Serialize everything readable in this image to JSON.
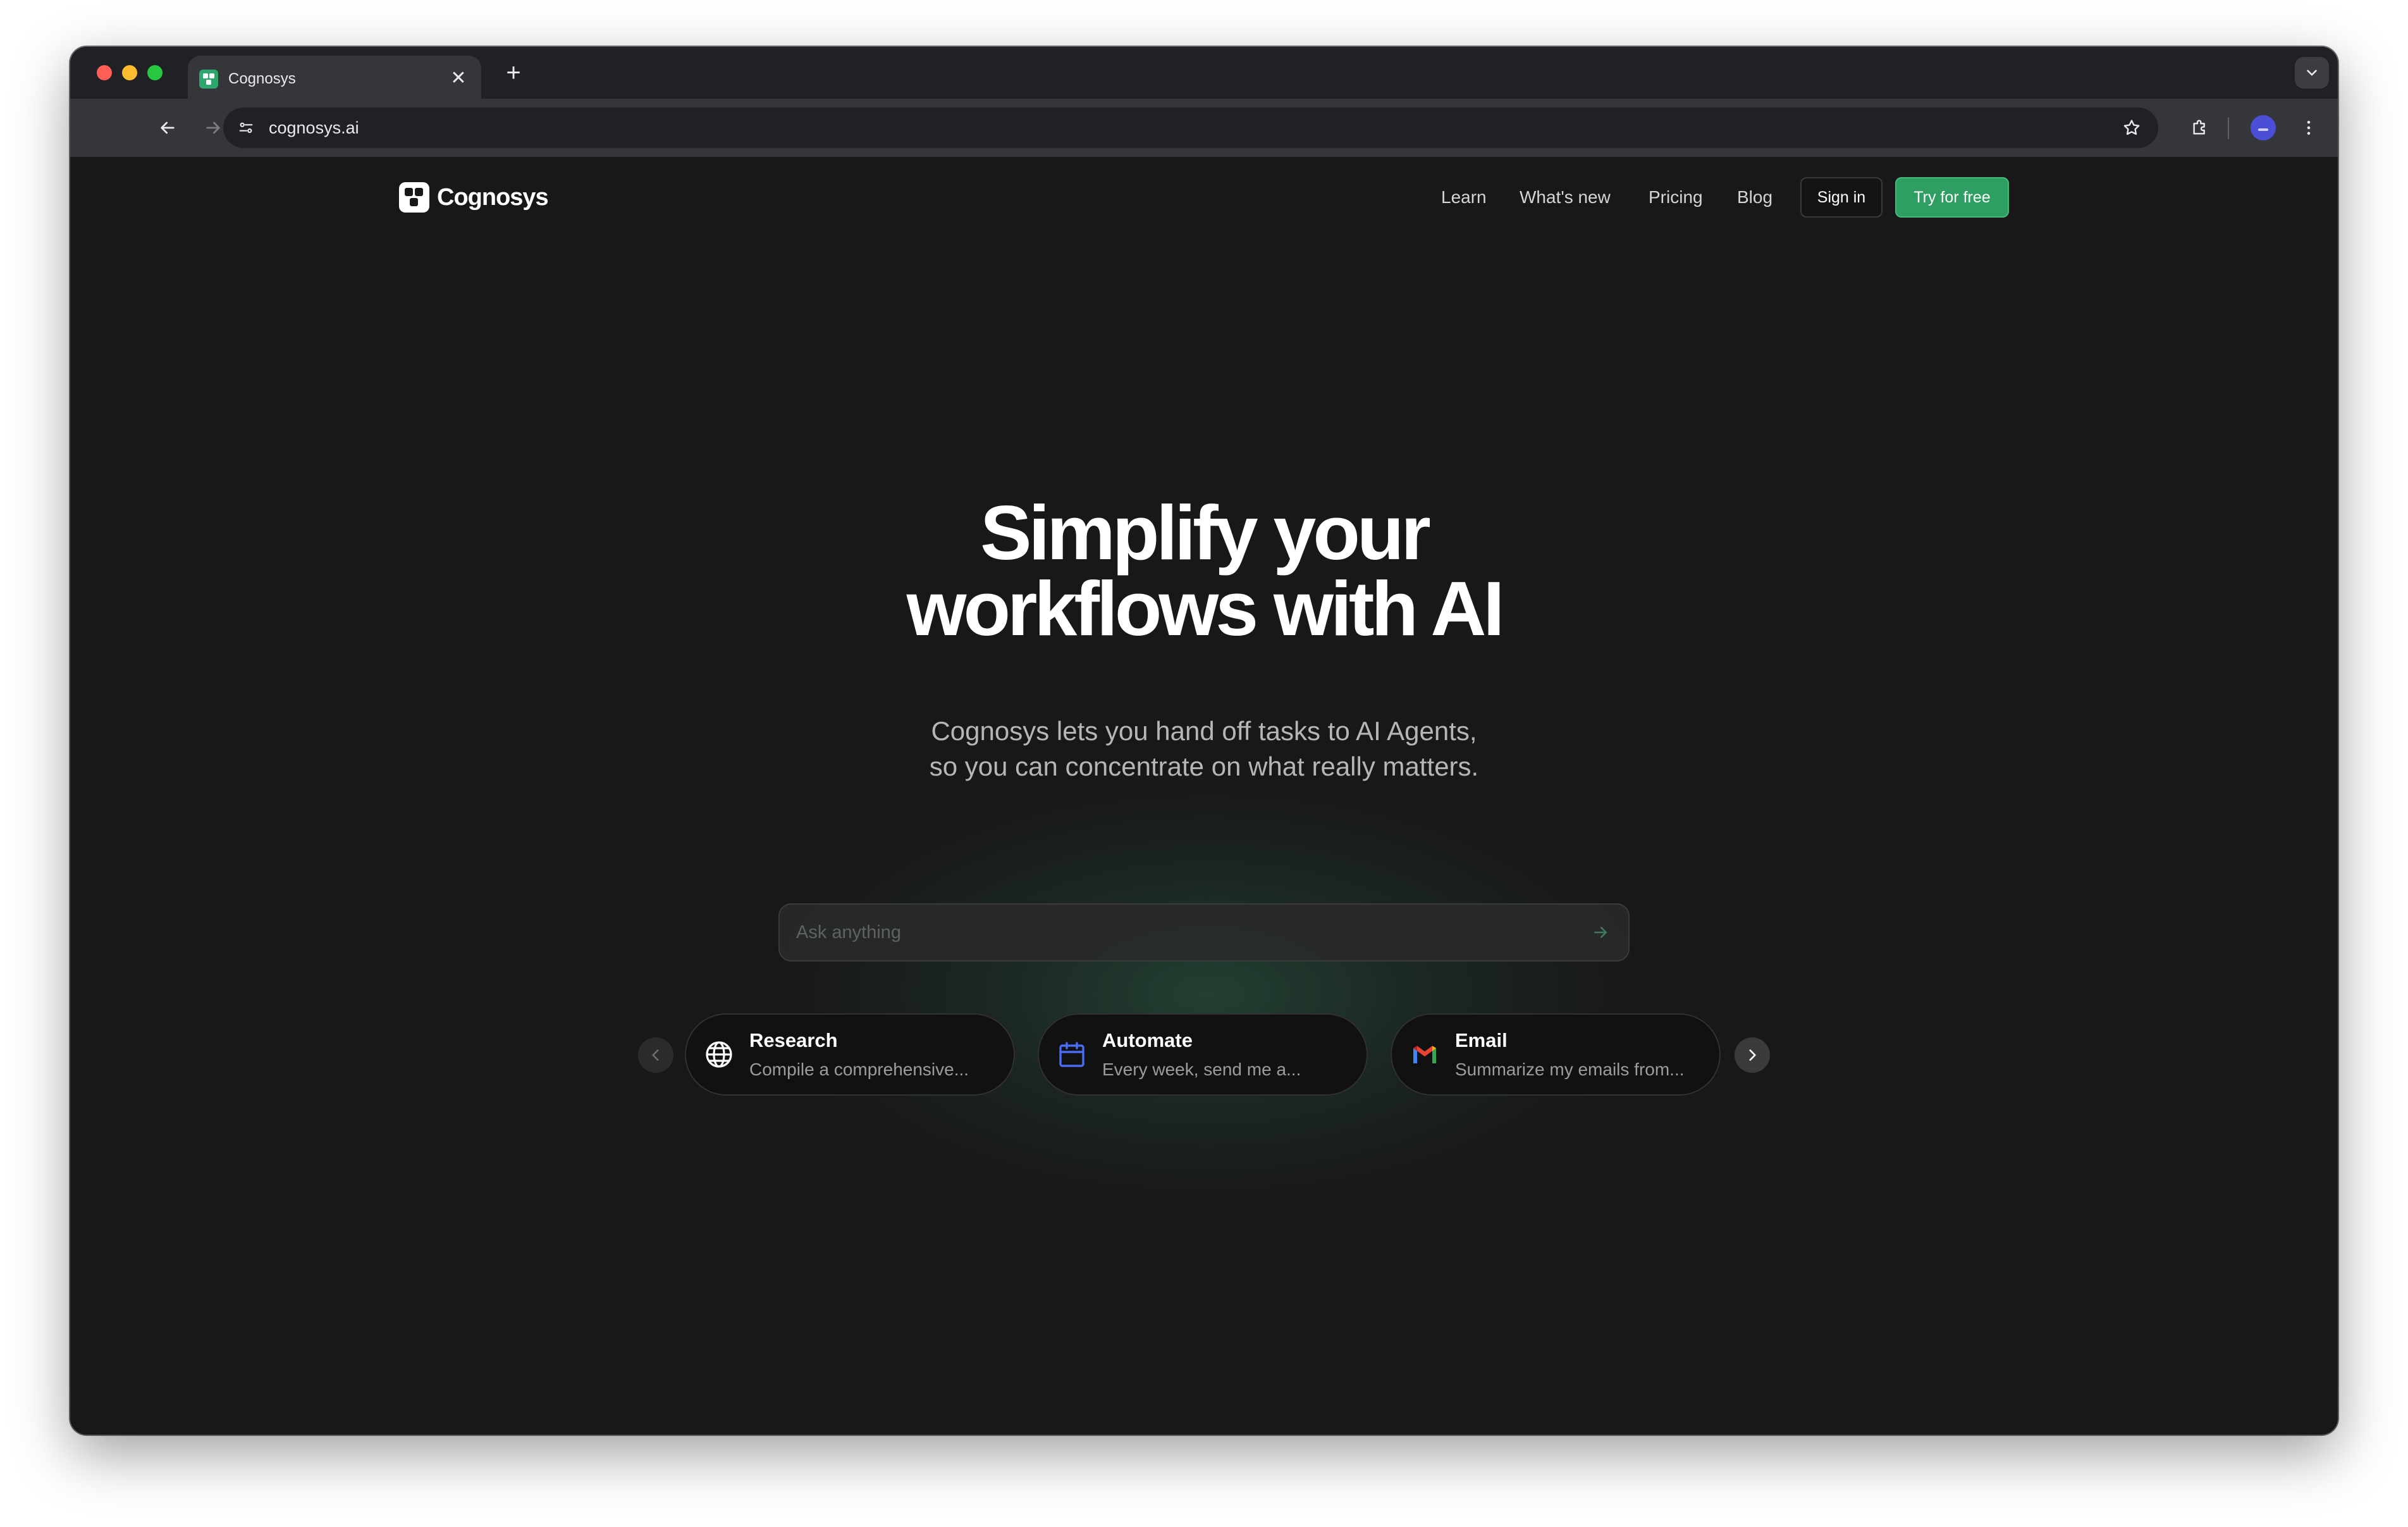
{
  "browser": {
    "tab": {
      "title": "Cognosys",
      "close_glyph": "✕"
    },
    "new_tab_glyph": "+",
    "url": "cognosys.ai",
    "colors": {
      "tab_strip": "#202124",
      "toolbar": "#35363a",
      "omnibox": "#202124"
    }
  },
  "site": {
    "logo_text": "Cognosys",
    "nav": {
      "links": [
        "Learn",
        "What's new",
        "Pricing",
        "Blog"
      ],
      "sign_in": "Sign in",
      "try_free": "Try for free"
    },
    "hero": {
      "title_line1": "Simplify your",
      "title_line2": "workflows with AI",
      "subtitle_line1": "Cognosys lets you hand off tasks to AI Agents,",
      "subtitle_line2": "so you can concentrate on what really matters."
    },
    "search": {
      "placeholder": "Ask anything"
    },
    "cards": [
      {
        "icon": "globe-icon",
        "title": "Research",
        "description": "Compile a comprehensive..."
      },
      {
        "icon": "calendar-icon",
        "title": "Automate",
        "description": "Every week, send me a..."
      },
      {
        "icon": "gmail-icon",
        "title": "Email",
        "description": "Summarize my emails from..."
      }
    ],
    "colors": {
      "accent": "#2f9e62",
      "background": "#181818",
      "card_bg": "#111111"
    }
  }
}
